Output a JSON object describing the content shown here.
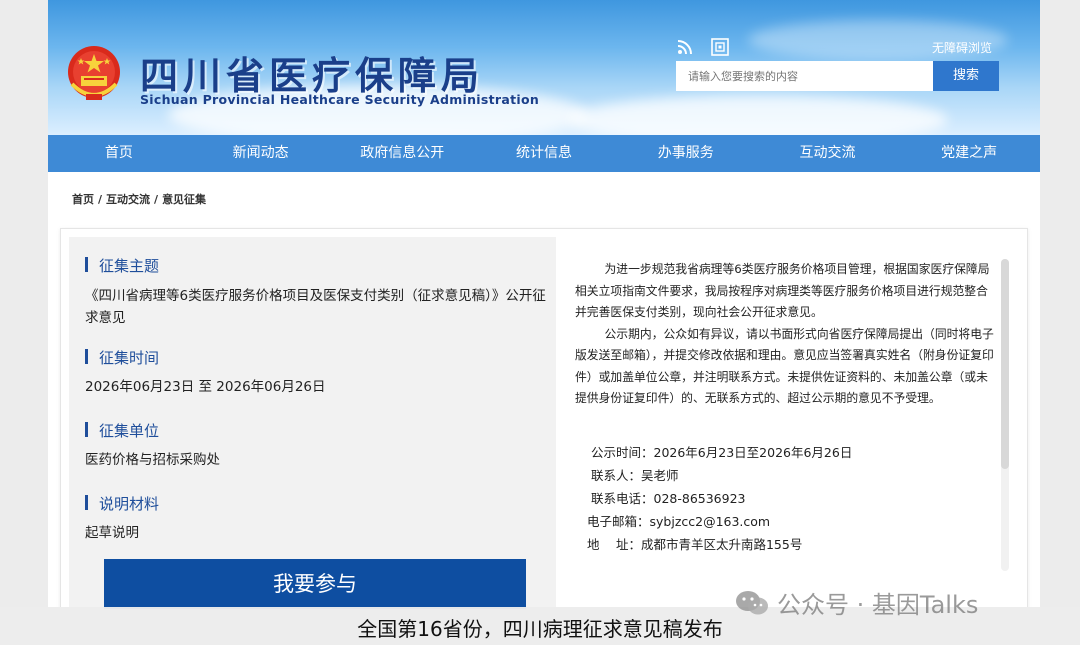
{
  "header": {
    "title_cn": "四川省医疗保障局",
    "title_en": "Sichuan Provincial Healthcare Security Administration",
    "accessibility_link": "无障碍浏览",
    "search_placeholder": "请输入您要搜索的内容",
    "search_button": "搜索",
    "icons": [
      "rss-icon",
      "app-icon"
    ]
  },
  "nav": {
    "items": [
      "首页",
      "新闻动态",
      "政府信息公开",
      "统计信息",
      "办事服务",
      "互动交流",
      "党建之声"
    ]
  },
  "breadcrumb": [
    "首页",
    "互动交流",
    "意见征集"
  ],
  "left": {
    "topic_title": "征集主题",
    "topic_body": "《四川省病理等6类医疗服务价格项目及医保支付类别（征求意见稿）》公开征求意见",
    "time_title": "征集时间",
    "time_body": "2026年06月23日 至 2026年06月26日",
    "unit_title": "征集单位",
    "unit_body": "医药价格与招标采购处",
    "material_title": "说明材料",
    "material_body": "起草说明",
    "join_button": "我要参与"
  },
  "right": {
    "para1": "为进一步规范我省病理等6类医疗服务价格项目管理，根据国家医疗保障局相关立项指南文件要求，我局按程序对病理类等医疗服务价格项目进行规范整合并完善医保支付类别，现向社会公开征求意见。",
    "para2": "公示期内，公众如有异议，请以书面形式向省医疗保障局提出（同时将电子版发送至邮箱），并提交修改依据和理由。意见应当签署真实姓名（附身份证复印件）或加盖单位公章，并注明联系方式。未提供佐证资料的、未加盖公章（或未提供身份证复印件）的、无联系方式的、超过公示期的意见不予受理。",
    "time_line": "公示时间：2026年6月23日至2026年6月26日",
    "contact_line": "联系人：吴老师",
    "phone_line": "联系电话：028-86536923",
    "email_line": "电子邮箱：sybjzcc2@163.com",
    "address_line": "地　 址：成都市青羊区太升南路155号"
  },
  "caption": "全国第16省份，四川病理征求意见稿发布",
  "watermark": "公众号 · 基因Talks",
  "colors": {
    "nav": "#3e8ad6",
    "title": "#1a3f8a",
    "join_button": "#0e4ea1",
    "section_title": "#1f4e9b"
  }
}
